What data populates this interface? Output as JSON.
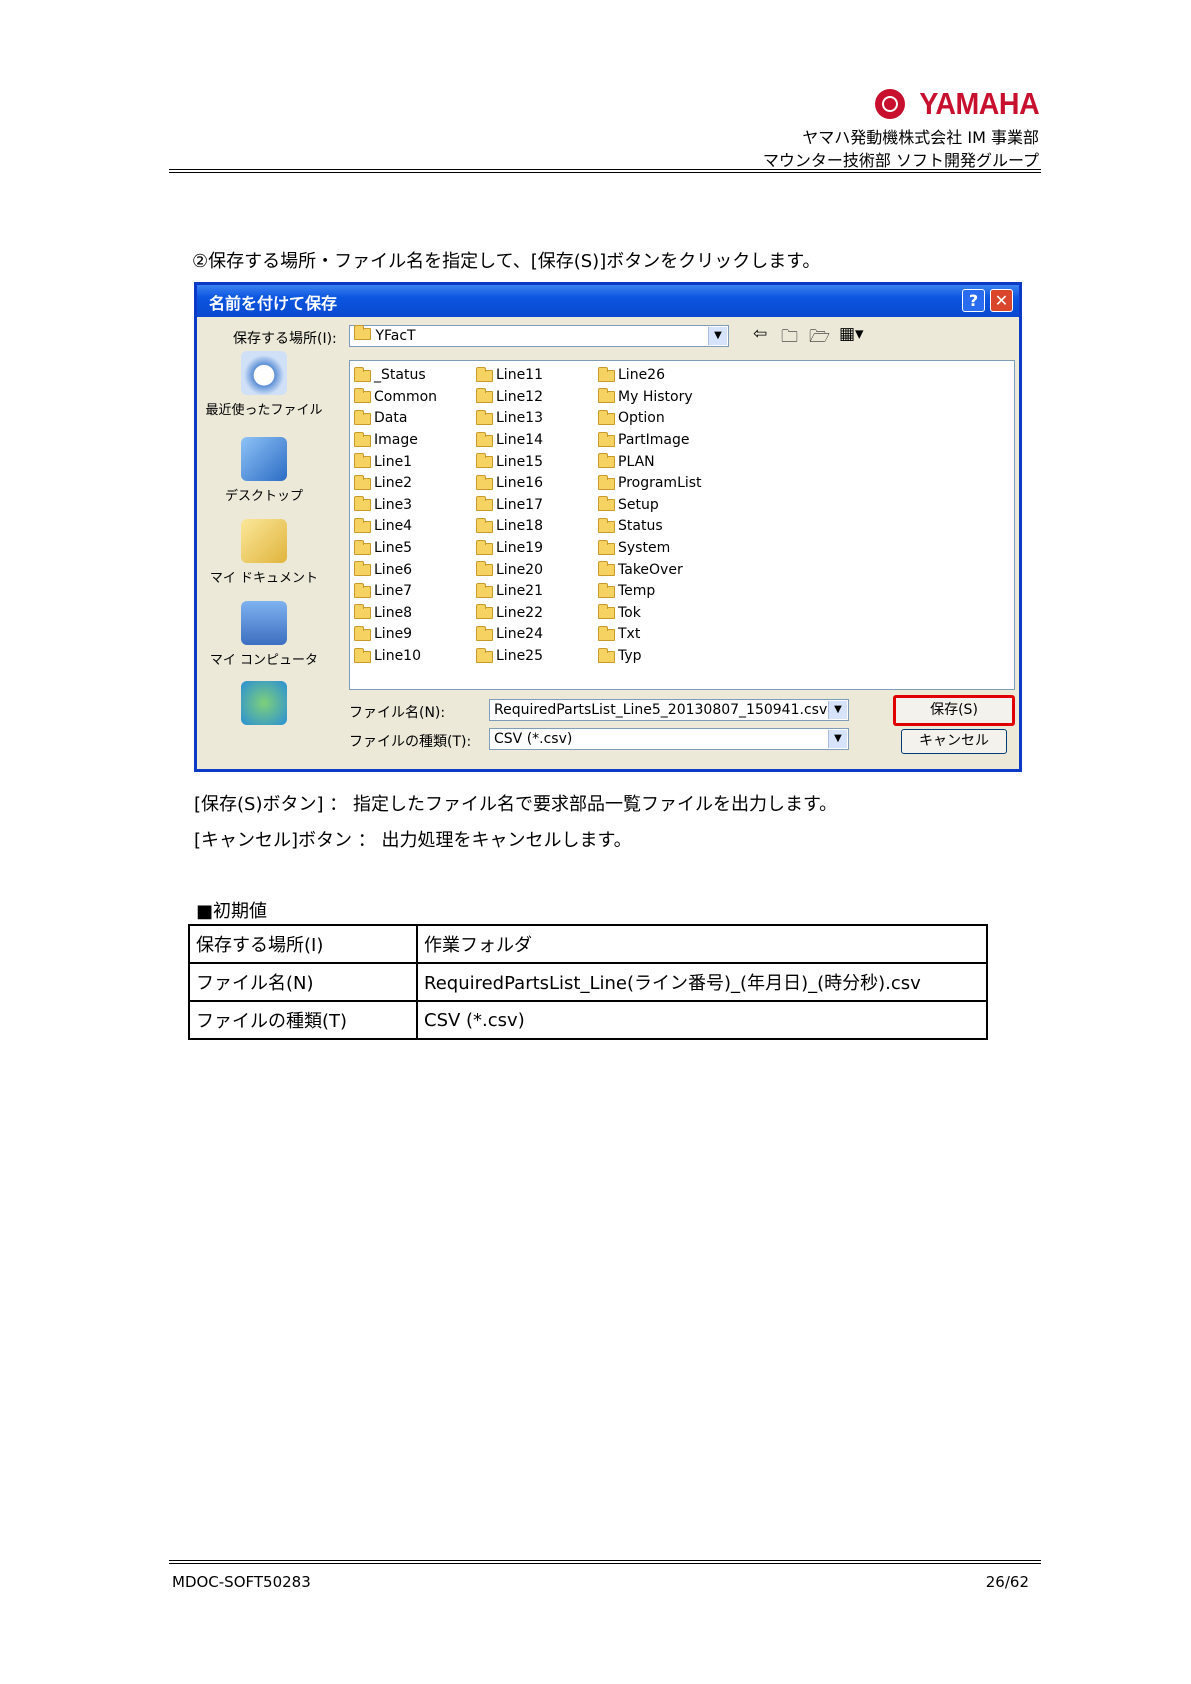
{
  "header": {
    "brand": "YAMAHA",
    "company": "ヤマハ発動機株式会社 IM 事業部",
    "department": "マウンター技術部 ソフト開発グループ"
  },
  "instruction": "②保存する場所・ファイル名を指定して、[保存(S)]ボタンをクリックします。",
  "dialog": {
    "title": "名前を付けて保存",
    "help_glyph": "?",
    "close_glyph": "✕",
    "save_in_label": "保存する場所(I):",
    "save_in_value": "YFacT",
    "places": [
      "最近使ったファイル",
      "デスクトップ",
      "マイ ドキュメント",
      "マイ コンピュータ"
    ],
    "folders_col1": [
      "_Status",
      "Common",
      "Data",
      "Image",
      "Line1",
      "Line2",
      "Line3",
      "Line4",
      "Line5",
      "Line6",
      "Line7",
      "Line8",
      "Line9",
      "Line10"
    ],
    "folders_col2": [
      "Line11",
      "Line12",
      "Line13",
      "Line14",
      "Line15",
      "Line16",
      "Line17",
      "Line18",
      "Line19",
      "Line20",
      "Line21",
      "Line22",
      "Line24",
      "Line25"
    ],
    "folders_col3": [
      "Line26",
      "My History",
      "Option",
      "PartImage",
      "PLAN",
      "ProgramList",
      "Setup",
      "Status",
      "System",
      "TakeOver",
      "Temp",
      "Tok",
      "Txt",
      "Typ"
    ],
    "filename_label": "ファイル名(N):",
    "filename_value": "RequiredPartsList_Line5_20130807_150941.csv",
    "filetype_label": "ファイルの種類(T):",
    "filetype_value": "CSV (*.csv)",
    "save_button": "保存(S)",
    "cancel_button": "キャンセル"
  },
  "notes": {
    "save": "[保存(S)ボタン] ： 指定したファイル名で要求部品一覧ファイルを出力します。",
    "cancel": "[キャンセル]ボタン ： 出力処理をキャンセルします。"
  },
  "defaults": {
    "heading": "■初期値",
    "rows": [
      {
        "label": "保存する場所(I)",
        "value": "作業フォルダ"
      },
      {
        "label": "ファイル名(N)",
        "value": "RequiredPartsList_Line(ライン番号)_(年月日)_(時分秒).csv"
      },
      {
        "label": "ファイルの種類(T)",
        "value": "CSV (*.csv)"
      }
    ]
  },
  "footer": {
    "doc_id": "MDOC-SOFT50283",
    "page": "26/62"
  }
}
